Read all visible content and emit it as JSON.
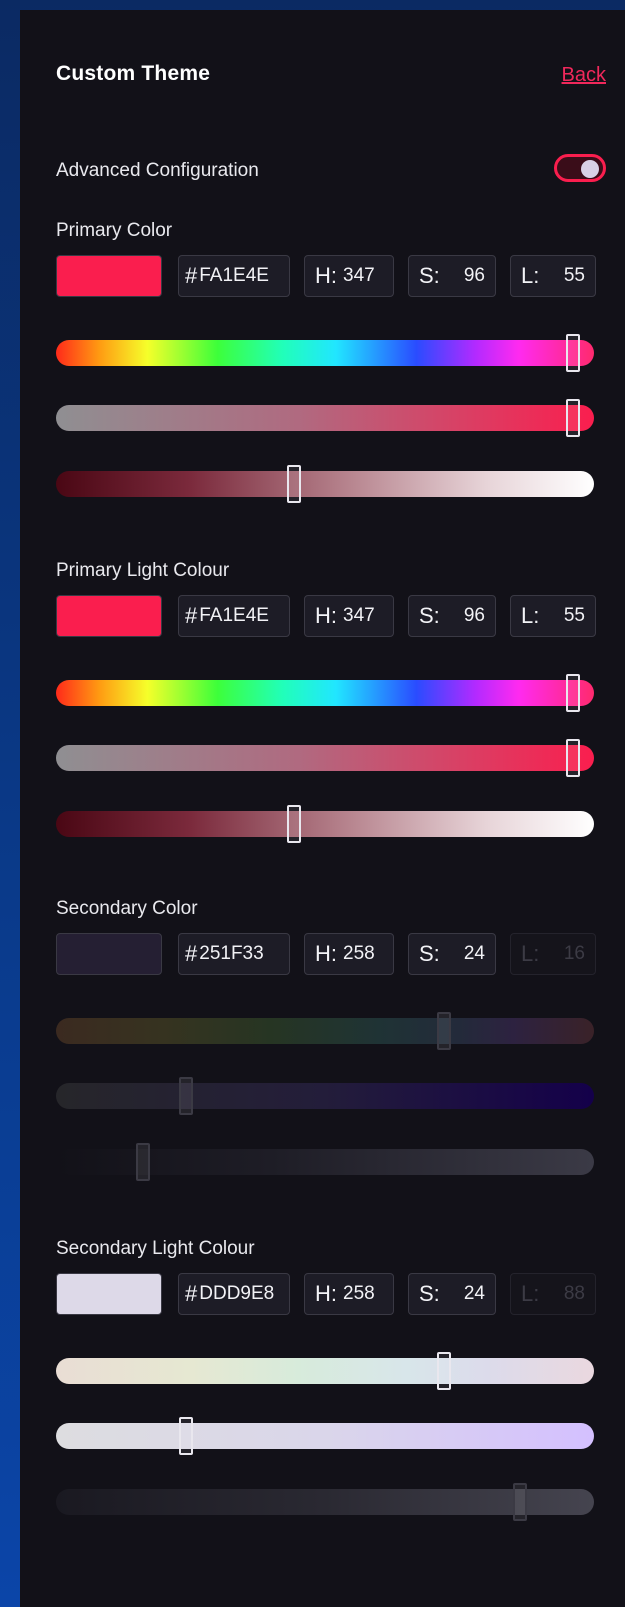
{
  "header": {
    "title": "Custom Theme",
    "back_label": "Back"
  },
  "advanced": {
    "label": "Advanced Configuration",
    "enabled": true
  },
  "sections": [
    {
      "label": "Primary Color",
      "swatch": "#FA1E4E",
      "hex": "FA1E4E",
      "h": "347",
      "s": "96",
      "l": "55",
      "l_disabled": false,
      "sliders": [
        {
          "name": "hue",
          "value": 0.96
        },
        {
          "name": "saturation",
          "value": 0.96
        },
        {
          "name": "lightness",
          "value": 0.44
        }
      ]
    },
    {
      "label": "Primary Light Colour",
      "swatch": "#FA1E4E",
      "hex": "FA1E4E",
      "h": "347",
      "s": "96",
      "l": "55",
      "l_disabled": false,
      "sliders": [
        {
          "name": "hue",
          "value": 0.96
        },
        {
          "name": "saturation",
          "value": 0.96
        },
        {
          "name": "lightness",
          "value": 0.44
        }
      ]
    },
    {
      "label": "Secondary Color",
      "swatch": "#251F33",
      "hex": "251F33",
      "h": "258",
      "s": "24",
      "l": "16",
      "l_disabled": true,
      "sliders": [
        {
          "name": "hue",
          "value": 0.72
        },
        {
          "name": "saturation",
          "value": 0.24
        },
        {
          "name": "lightness",
          "value": 0.16
        }
      ]
    },
    {
      "label": "Secondary Light Colour",
      "swatch": "#DDD9E8",
      "hex": "DDD9E8",
      "h": "258",
      "s": "24",
      "l": "88",
      "l_disabled": true,
      "sliders": [
        {
          "name": "hue",
          "value": 0.72
        },
        {
          "name": "saturation",
          "value": 0.24
        },
        {
          "name": "lightness",
          "value": 0.86
        }
      ]
    }
  ],
  "field_labels": {
    "hash": "#",
    "h": "H:",
    "s": "S:",
    "l": "L:"
  },
  "colors": {
    "accent": "#FA1E4E",
    "panel": "#121118",
    "background": "#0A3A8A"
  }
}
